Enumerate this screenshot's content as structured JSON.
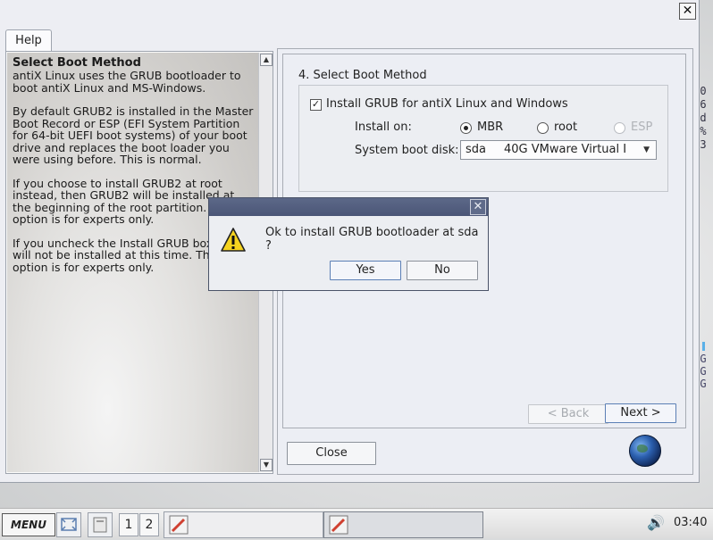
{
  "window": {
    "tab_label": "Help",
    "close_symbol": "✕"
  },
  "help": {
    "title": "Select Boot Method",
    "paragraphs": [
      "antiX Linux uses the GRUB bootloader to boot antiX Linux and MS-Windows.",
      "By default GRUB2 is installed in the Master Boot Record or ESP (EFI System Partition for 64-bit UEFI boot systems) of your boot drive and replaces the boot loader you were using before. This is normal.",
      "If you choose to install GRUB2 at root instead, then GRUB2 will be installed at the beginning of the root partition. This option is for experts only.",
      "If you uncheck the Install GRUB box, GRUB will not be installed at this time. This option is for experts only."
    ]
  },
  "main": {
    "step_title": "4. Select Boot Method",
    "install_grub_label": "Install GRUB for antiX Linux and Windows",
    "install_grub_checked": true,
    "install_on_label": "Install on:",
    "options": [
      {
        "label": "MBR",
        "selected": true,
        "enabled": true
      },
      {
        "label": "root",
        "selected": false,
        "enabled": true
      },
      {
        "label": "ESP",
        "selected": false,
        "enabled": false
      }
    ],
    "boot_disk_label": "System boot disk:",
    "boot_disk_value": "sda",
    "boot_disk_desc": "40G VMware Virtual I",
    "back_button": "< Back",
    "next_button": "Next >",
    "close_button": "Close"
  },
  "dialog": {
    "message": "Ok to install GRUB bootloader at sda ?",
    "yes_button": "Yes",
    "no_button": "No",
    "close_symbol": "✕"
  },
  "desktop": {
    "right_chars_top": [
      "0",
      "6",
      "d",
      "%",
      "3"
    ],
    "right_chars_bottom": [
      "G",
      "G",
      "G"
    ]
  },
  "taskbar": {
    "menu_label": "MENU",
    "workspace_1": "1",
    "workspace_2": "2",
    "clock": "03:40",
    "volume_icon": "🔊"
  },
  "colors": {
    "dialog_titlebar": "#525d7e",
    "window_bg": "#edeef3"
  }
}
